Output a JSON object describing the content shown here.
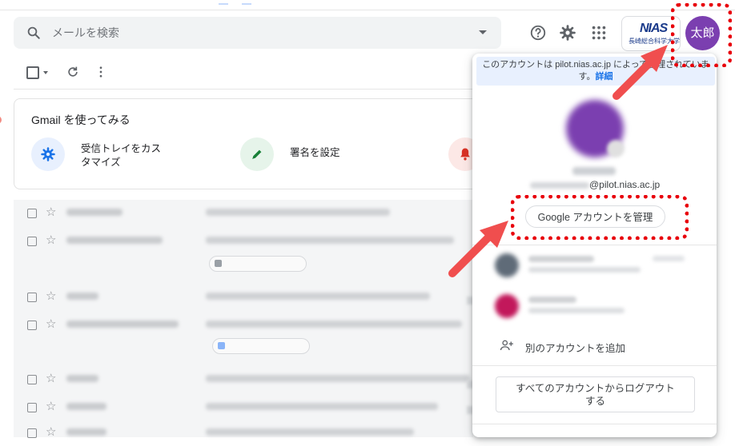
{
  "header": {
    "search_placeholder": "メールを検索",
    "icons": [
      "search-icon",
      "help-icon",
      "gear-icon",
      "apps-icon"
    ],
    "org_logo_text": "NIAS",
    "org_logo_subtitle": "長崎総合科学大学",
    "avatar_label": "太郎",
    "avatar_color": "#7b3fb0"
  },
  "toolbar": {
    "icons": [
      "checkbox-icon",
      "refresh-icon",
      "more-vert-icon"
    ]
  },
  "getting_started": {
    "title": "Gmail を使ってみる",
    "items": [
      {
        "label_line1": "受信トレイをカス",
        "label_line2": "タマイズ",
        "icon": "gear-icon",
        "color": "#1a73e8"
      },
      {
        "label_line1": "署名を設定",
        "icon": "pen-icon",
        "color": "#188038"
      },
      {
        "icon": "bell-icon",
        "color": "#d93025"
      }
    ]
  },
  "account_panel": {
    "managed_notice_line1": "このアカウントは pilot.nias.ac.jp によって管理されていま",
    "managed_notice_line2": "す。",
    "managed_link": "詳細",
    "email_domain": "@pilot.nias.ac.jp",
    "manage_button": "Google アカウントを管理",
    "add_account": "別のアカウントを追加",
    "logout_line1": "すべてのアカウントからログアウト",
    "logout_line2": "する"
  },
  "annotation_color": "#e8000b",
  "arrow_color": "#f04e4e"
}
